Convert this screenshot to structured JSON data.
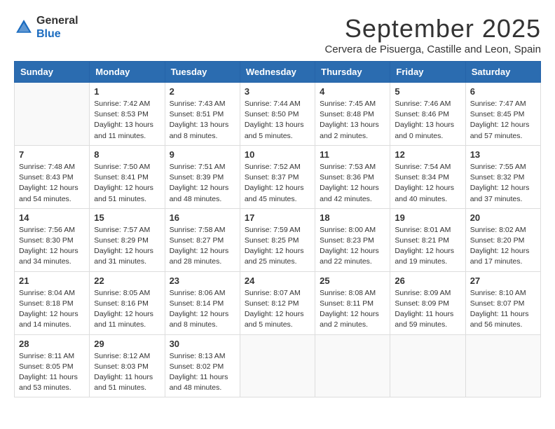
{
  "logo": {
    "general": "General",
    "blue": "Blue"
  },
  "title": "September 2025",
  "subtitle": "Cervera de Pisuerga, Castille and Leon, Spain",
  "headers": [
    "Sunday",
    "Monday",
    "Tuesday",
    "Wednesday",
    "Thursday",
    "Friday",
    "Saturday"
  ],
  "weeks": [
    [
      {
        "day": "",
        "info": ""
      },
      {
        "day": "1",
        "info": "Sunrise: 7:42 AM\nSunset: 8:53 PM\nDaylight: 13 hours\nand 11 minutes."
      },
      {
        "day": "2",
        "info": "Sunrise: 7:43 AM\nSunset: 8:51 PM\nDaylight: 13 hours\nand 8 minutes."
      },
      {
        "day": "3",
        "info": "Sunrise: 7:44 AM\nSunset: 8:50 PM\nDaylight: 13 hours\nand 5 minutes."
      },
      {
        "day": "4",
        "info": "Sunrise: 7:45 AM\nSunset: 8:48 PM\nDaylight: 13 hours\nand 2 minutes."
      },
      {
        "day": "5",
        "info": "Sunrise: 7:46 AM\nSunset: 8:46 PM\nDaylight: 13 hours\nand 0 minutes."
      },
      {
        "day": "6",
        "info": "Sunrise: 7:47 AM\nSunset: 8:45 PM\nDaylight: 12 hours\nand 57 minutes."
      }
    ],
    [
      {
        "day": "7",
        "info": "Sunrise: 7:48 AM\nSunset: 8:43 PM\nDaylight: 12 hours\nand 54 minutes."
      },
      {
        "day": "8",
        "info": "Sunrise: 7:50 AM\nSunset: 8:41 PM\nDaylight: 12 hours\nand 51 minutes."
      },
      {
        "day": "9",
        "info": "Sunrise: 7:51 AM\nSunset: 8:39 PM\nDaylight: 12 hours\nand 48 minutes."
      },
      {
        "day": "10",
        "info": "Sunrise: 7:52 AM\nSunset: 8:37 PM\nDaylight: 12 hours\nand 45 minutes."
      },
      {
        "day": "11",
        "info": "Sunrise: 7:53 AM\nSunset: 8:36 PM\nDaylight: 12 hours\nand 42 minutes."
      },
      {
        "day": "12",
        "info": "Sunrise: 7:54 AM\nSunset: 8:34 PM\nDaylight: 12 hours\nand 40 minutes."
      },
      {
        "day": "13",
        "info": "Sunrise: 7:55 AM\nSunset: 8:32 PM\nDaylight: 12 hours\nand 37 minutes."
      }
    ],
    [
      {
        "day": "14",
        "info": "Sunrise: 7:56 AM\nSunset: 8:30 PM\nDaylight: 12 hours\nand 34 minutes."
      },
      {
        "day": "15",
        "info": "Sunrise: 7:57 AM\nSunset: 8:29 PM\nDaylight: 12 hours\nand 31 minutes."
      },
      {
        "day": "16",
        "info": "Sunrise: 7:58 AM\nSunset: 8:27 PM\nDaylight: 12 hours\nand 28 minutes."
      },
      {
        "day": "17",
        "info": "Sunrise: 7:59 AM\nSunset: 8:25 PM\nDaylight: 12 hours\nand 25 minutes."
      },
      {
        "day": "18",
        "info": "Sunrise: 8:00 AM\nSunset: 8:23 PM\nDaylight: 12 hours\nand 22 minutes."
      },
      {
        "day": "19",
        "info": "Sunrise: 8:01 AM\nSunset: 8:21 PM\nDaylight: 12 hours\nand 19 minutes."
      },
      {
        "day": "20",
        "info": "Sunrise: 8:02 AM\nSunset: 8:20 PM\nDaylight: 12 hours\nand 17 minutes."
      }
    ],
    [
      {
        "day": "21",
        "info": "Sunrise: 8:04 AM\nSunset: 8:18 PM\nDaylight: 12 hours\nand 14 minutes."
      },
      {
        "day": "22",
        "info": "Sunrise: 8:05 AM\nSunset: 8:16 PM\nDaylight: 12 hours\nand 11 minutes."
      },
      {
        "day": "23",
        "info": "Sunrise: 8:06 AM\nSunset: 8:14 PM\nDaylight: 12 hours\nand 8 minutes."
      },
      {
        "day": "24",
        "info": "Sunrise: 8:07 AM\nSunset: 8:12 PM\nDaylight: 12 hours\nand 5 minutes."
      },
      {
        "day": "25",
        "info": "Sunrise: 8:08 AM\nSunset: 8:11 PM\nDaylight: 12 hours\nand 2 minutes."
      },
      {
        "day": "26",
        "info": "Sunrise: 8:09 AM\nSunset: 8:09 PM\nDaylight: 11 hours\nand 59 minutes."
      },
      {
        "day": "27",
        "info": "Sunrise: 8:10 AM\nSunset: 8:07 PM\nDaylight: 11 hours\nand 56 minutes."
      }
    ],
    [
      {
        "day": "28",
        "info": "Sunrise: 8:11 AM\nSunset: 8:05 PM\nDaylight: 11 hours\nand 53 minutes."
      },
      {
        "day": "29",
        "info": "Sunrise: 8:12 AM\nSunset: 8:03 PM\nDaylight: 11 hours\nand 51 minutes."
      },
      {
        "day": "30",
        "info": "Sunrise: 8:13 AM\nSunset: 8:02 PM\nDaylight: 11 hours\nand 48 minutes."
      },
      {
        "day": "",
        "info": ""
      },
      {
        "day": "",
        "info": ""
      },
      {
        "day": "",
        "info": ""
      },
      {
        "day": "",
        "info": ""
      }
    ]
  ]
}
